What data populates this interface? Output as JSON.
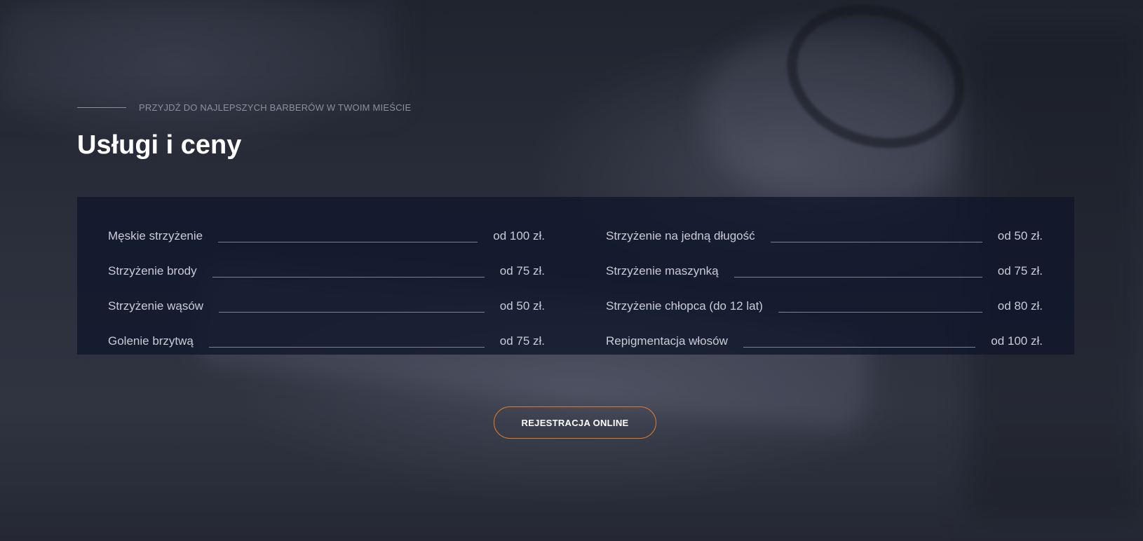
{
  "section": {
    "eyebrow": "PRZYJDŹ DO NAJLEPSZYCH BARBERÓW W TWOIM MIEŚCIE",
    "title": "Usługi i ceny"
  },
  "prices": {
    "left": [
      {
        "name": "Męskie strzyżenie",
        "price": "od 100 zł."
      },
      {
        "name": "Strzyżenie brody",
        "price": "od 75 zł."
      },
      {
        "name": "Strzyżenie wąsów",
        "price": "od 50 zł."
      },
      {
        "name": "Golenie brzytwą",
        "price": "od 75 zł."
      }
    ],
    "right": [
      {
        "name": "Strzyżenie na jedną długość",
        "price": "od 50 zł."
      },
      {
        "name": "Strzyżenie maszynką",
        "price": "od 75 zł."
      },
      {
        "name": "Strzyżenie chłopca (do 12 lat)",
        "price": "od 80 zł."
      },
      {
        "name": "Repigmentacja włosów",
        "price": "od 100 zł."
      }
    ]
  },
  "cta": {
    "label": "REJESTRACJA ONLINE"
  },
  "colors": {
    "accent": "#e07a2a",
    "panel": "#10162a",
    "text": "#c9ccd6"
  }
}
